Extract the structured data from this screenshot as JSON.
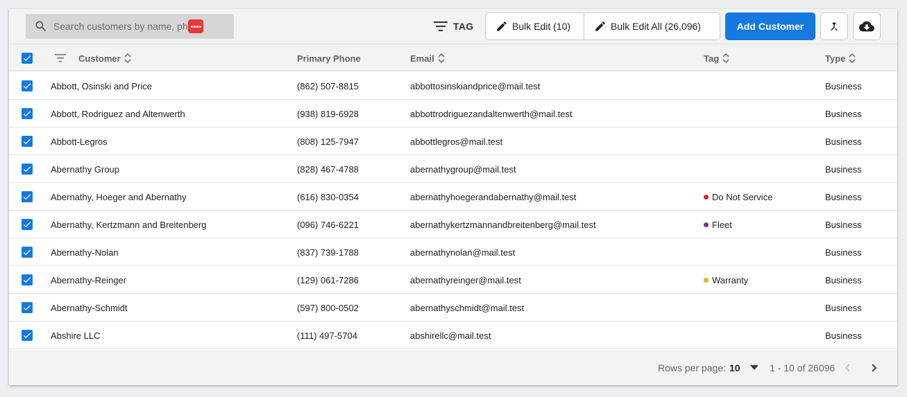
{
  "toolbar": {
    "search_placeholder": "Search customers by name, phone or email",
    "tag_label": "TAG",
    "bulk_edit_label": "Bulk Edit (10)",
    "bulk_edit_all_label": "Bulk Edit All (26,096)",
    "add_customer_label": "Add Customer"
  },
  "table": {
    "columns": {
      "customer": "Customer",
      "phone": "Primary Phone",
      "email": "Email",
      "tag": "Tag",
      "type": "Type"
    },
    "rows": [
      {
        "customer": "Abbott, Osinski and Price",
        "phone": "(862) 507-8815",
        "email": "abbottosinskiandprice@mail.test",
        "tag": "",
        "tag_color": "",
        "type": "Business",
        "checked": true
      },
      {
        "customer": "Abbott, Rodriguez and Altenwerth",
        "phone": "(938) 819-6928",
        "email": "abbottrodriguezandaltenwerth@mail.test",
        "tag": "",
        "tag_color": "",
        "type": "Business",
        "checked": true
      },
      {
        "customer": "Abbott-Legros",
        "phone": "(808) 125-7947",
        "email": "abbottlegros@mail.test",
        "tag": "",
        "tag_color": "",
        "type": "Business",
        "checked": true
      },
      {
        "customer": "Abernathy Group",
        "phone": "(828) 467-4788",
        "email": "abernathygroup@mail.test",
        "tag": "",
        "tag_color": "",
        "type": "Business",
        "checked": true
      },
      {
        "customer": "Abernathy, Hoeger and Abernathy",
        "phone": "(616) 830-0354",
        "email": "abernathyhoegerandabernathy@mail.test",
        "tag": "Do Not Service",
        "tag_color": "#e0202a",
        "type": "Business",
        "checked": true
      },
      {
        "customer": "Abernathy, Kertzmann and Breitenberg",
        "phone": "(096) 746-6221",
        "email": "abernathykertzmannandbreitenberg@mail.test",
        "tag": "Fleet",
        "tag_color": "#8e24aa",
        "type": "Business",
        "checked": true
      },
      {
        "customer": "Abernathy-Nolan",
        "phone": "(837) 739-1788",
        "email": "abernathynolan@mail.test",
        "tag": "",
        "tag_color": "",
        "type": "Business",
        "checked": true
      },
      {
        "customer": "Abernathy-Reinger",
        "phone": "(129) 061-7286",
        "email": "abernathyreinger@mail.test",
        "tag": "Warranty",
        "tag_color": "#f9a825",
        "type": "Business",
        "checked": true
      },
      {
        "customer": "Abernathy-Schmidt",
        "phone": "(597) 800-0502",
        "email": "abernathyschmidt@mail.test",
        "tag": "",
        "tag_color": "",
        "type": "Business",
        "checked": true
      },
      {
        "customer": "Abshire LLC",
        "phone": "(111) 497-5704",
        "email": "abshirellc@mail.test",
        "tag": "",
        "tag_color": "",
        "type": "Business",
        "checked": true
      }
    ]
  },
  "footer": {
    "rows_per_page_label": "Rows per page:",
    "rows_per_page_value": "10",
    "range_label": "1 - 10 of 26096"
  },
  "colors": {
    "accent": "#1679e0"
  }
}
